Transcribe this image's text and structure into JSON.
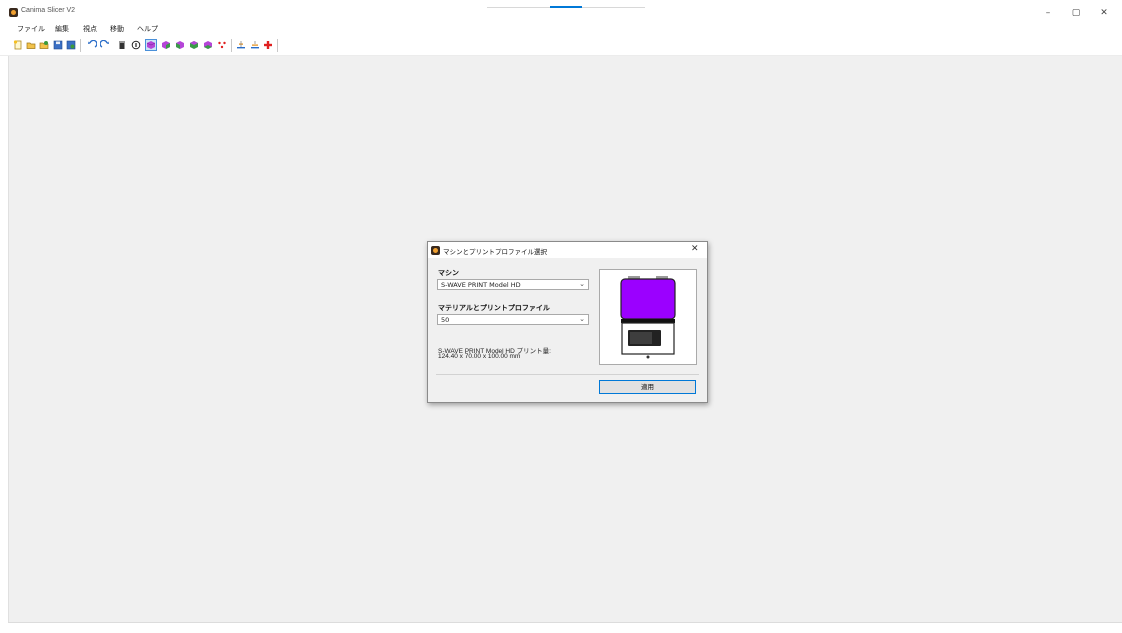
{
  "app": {
    "title": "Canima Slicer V2",
    "window_controls": [
      "–",
      "▢",
      "✕"
    ]
  },
  "menu": {
    "items": [
      "ファイル",
      "編集",
      "視点",
      "移動",
      "ヘルプ"
    ]
  },
  "toolbar": {
    "icons": [
      "new-icon",
      "open-icon",
      "import-icon",
      "save-icon",
      "export-icon",
      "undo-icon",
      "redo-icon",
      "delete-icon",
      "info-icon",
      "view-front-icon",
      "view-back-icon",
      "view-left-icon",
      "view-right-icon",
      "view-top-icon",
      "support-icon",
      "layer-icon",
      "lift-icon",
      "add-icon"
    ],
    "selected": "view-front-icon"
  },
  "dialog": {
    "title": "マシンとプリントプロファイル選択",
    "close": "✕",
    "machine_label": "マシン",
    "machine_value": "S-WAVE PRINT Model HD",
    "material_label": "マテリアルとプリントプロファイル",
    "material_value": "50",
    "info_line1": "S-WAVE PRINT Model HD プリント量:",
    "info_line2": "124.40 x 70.00 x 100.00 mm",
    "apply_label": "適用",
    "printer_color": "#9b00ff"
  },
  "colors": {
    "accent": "#0078d7",
    "workspace": "#f0f0f0"
  }
}
